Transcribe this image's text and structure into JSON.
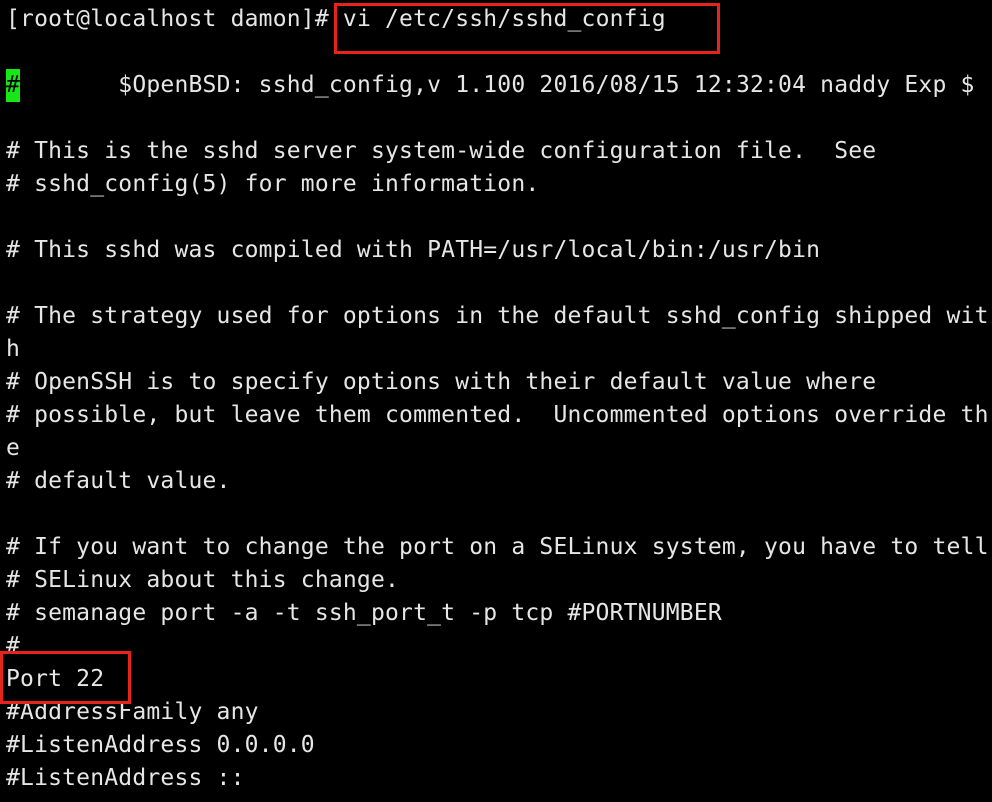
{
  "terminal": {
    "prompt": "[root@localhost damon]#",
    "command": "vi /etc/ssh/sshd_config",
    "cursor_char": "#",
    "lines": [
      "       $OpenBSD: sshd_config,v 1.100 2016/08/15 12:32:04 naddy Exp $",
      "",
      "# This is the sshd server system-wide configuration file.  See",
      "# sshd_config(5) for more information.",
      "",
      "# This sshd was compiled with PATH=/usr/local/bin:/usr/bin",
      "",
      "# The strategy used for options in the default sshd_config shipped wit",
      "h",
      "# OpenSSH is to specify options with their default value where",
      "# possible, but leave them commented.  Uncommented options override th",
      "e",
      "# default value.",
      "",
      "# If you want to change the port on a SELinux system, you have to tell",
      "# SELinux about this change.",
      "# semanage port -a -t ssh_port_t -p tcp #PORTNUMBER",
      "#",
      "Port 22",
      "#AddressFamily any",
      "#ListenAddress 0.0.0.0",
      "#ListenAddress ::"
    ]
  },
  "colors": {
    "background": "#000000",
    "text": "#e6e6e6",
    "cursor": "#17e617",
    "highlight_box": "#e8231b"
  }
}
